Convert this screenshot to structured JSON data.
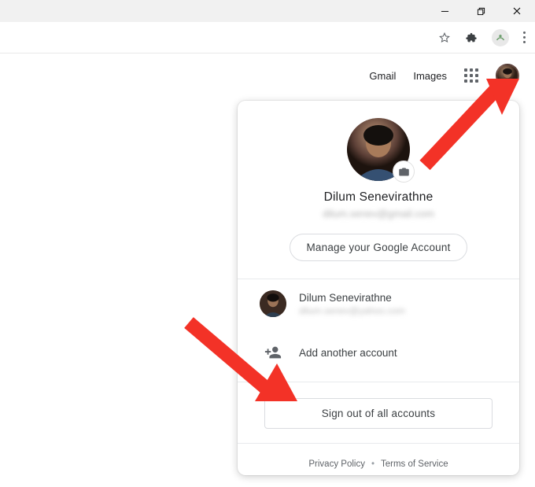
{
  "os": {
    "minimize_icon": "minimize",
    "maximize_icon": "restore",
    "close_icon": "close"
  },
  "browser": {
    "star_icon": "bookmark-star",
    "extensions_icon": "puzzle",
    "profile_icon": "profile-avatar",
    "menu_icon": "kebab"
  },
  "nav": {
    "gmail_label": "Gmail",
    "images_label": "Images",
    "apps_icon": "apps-grid",
    "account_icon": "account-avatar"
  },
  "popover": {
    "name": "Dilum Senevirathne",
    "email": "dilum.senev@gmail.com",
    "manage_label": "Manage your Google Account",
    "camera_icon": "camera",
    "other_account": {
      "name": "Dilum Senevirathne",
      "email": "dilum.senev@yahoo.com"
    },
    "add_account_label": "Add another account",
    "add_account_icon": "person-add",
    "signout_label": "Sign out of all accounts",
    "privacy_label": "Privacy Policy",
    "terms_label": "Terms of Service",
    "footer_separator": "•"
  },
  "colors": {
    "annotation_arrow": "#f33227",
    "text_primary": "#202124",
    "text_secondary": "#5f6368",
    "border": "#dadce0"
  }
}
